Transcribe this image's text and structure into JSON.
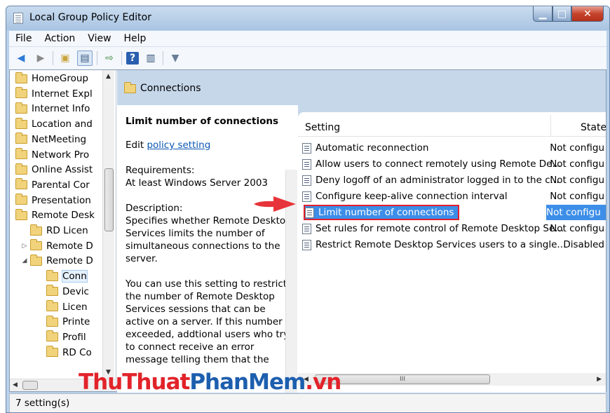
{
  "window": {
    "title": "Local Group Policy Editor"
  },
  "menu": [
    "File",
    "Action",
    "View",
    "Help"
  ],
  "toolbar": {
    "icons": [
      "back-arrow-icon",
      "forward-arrow-icon",
      "up-folder-icon",
      "show-hide-tree-icon",
      "export-list-icon",
      "help-icon",
      "properties-icon",
      "filter-icon"
    ]
  },
  "tree": {
    "items": [
      {
        "label": "HomeGroup",
        "indent": 0,
        "expander": ""
      },
      {
        "label": "Internet Expl",
        "indent": 0,
        "expander": ""
      },
      {
        "label": "Internet Info",
        "indent": 0,
        "expander": ""
      },
      {
        "label": "Location and",
        "indent": 0,
        "expander": ""
      },
      {
        "label": "NetMeeting",
        "indent": 0,
        "expander": ""
      },
      {
        "label": "Network Pro",
        "indent": 0,
        "expander": ""
      },
      {
        "label": "Online Assist",
        "indent": 0,
        "expander": ""
      },
      {
        "label": "Parental Cor",
        "indent": 0,
        "expander": ""
      },
      {
        "label": "Presentation",
        "indent": 0,
        "expander": ""
      },
      {
        "label": "Remote Desk",
        "indent": 0,
        "expander": ""
      },
      {
        "label": "RD Licen",
        "indent": 1,
        "expander": ""
      },
      {
        "label": "Remote D",
        "indent": 1,
        "expander": "▷"
      },
      {
        "label": "Remote D",
        "indent": 1,
        "expander": "◢"
      },
      {
        "label": "Conn",
        "indent": 2,
        "expander": "",
        "selected": true
      },
      {
        "label": "Devic",
        "indent": 2,
        "expander": ""
      },
      {
        "label": "Licen",
        "indent": 2,
        "expander": ""
      },
      {
        "label": "Printe",
        "indent": 2,
        "expander": ""
      },
      {
        "label": "Profil",
        "indent": 2,
        "expander": ""
      },
      {
        "label": "RD Co",
        "indent": 2,
        "expander": ""
      }
    ]
  },
  "header": {
    "title": "Connections"
  },
  "description": {
    "title": "Limit number of connections",
    "edit_prefix": "Edit ",
    "edit_link": "policy setting",
    "requirements_label": "Requirements:",
    "requirements_value": "At least Windows Server 2003",
    "description_label": "Description:",
    "lines1": [
      "Specifies whether Remote Desktop",
      "Services limits the number of",
      "simultaneous connections to the",
      "server."
    ],
    "lines2": [
      "You can use this setting to restrict",
      "the number of Remote Desktop",
      "Services sessions that can be",
      "active on a server. If this number is",
      "exceeded, addtional users who try",
      "to connect receive an error",
      "message telling them that the"
    ]
  },
  "list": {
    "col_setting": "Setting",
    "col_state": "State",
    "rows": [
      {
        "setting": "Automatic reconnection",
        "state": "Not configu"
      },
      {
        "setting": "Allow users to connect remotely using Remote De...",
        "state": "Not configu"
      },
      {
        "setting": "Deny logoff of an administrator logged in to the c...",
        "state": "Not configu"
      },
      {
        "setting": "Configure keep-alive connection interval",
        "state": "Not configu"
      },
      {
        "setting": "Limit number of connections",
        "state": "Not configu",
        "selected": true
      },
      {
        "setting": "Set rules for remote control of Remote Desktop Se...",
        "state": "Not configu"
      },
      {
        "setting": "Restrict Remote Desktop Services users to a single...",
        "state": "Disabled"
      }
    ],
    "scroll_grip": "III"
  },
  "status": {
    "text": "7 setting(s)"
  },
  "watermark": {
    "part1": "ThuThuat",
    "part2": "PhanMem",
    "part3": ".vn"
  },
  "colors": {
    "selection": "#3d8ee8",
    "highlight_border": "#e1202b",
    "arrow": "#e7343a"
  }
}
